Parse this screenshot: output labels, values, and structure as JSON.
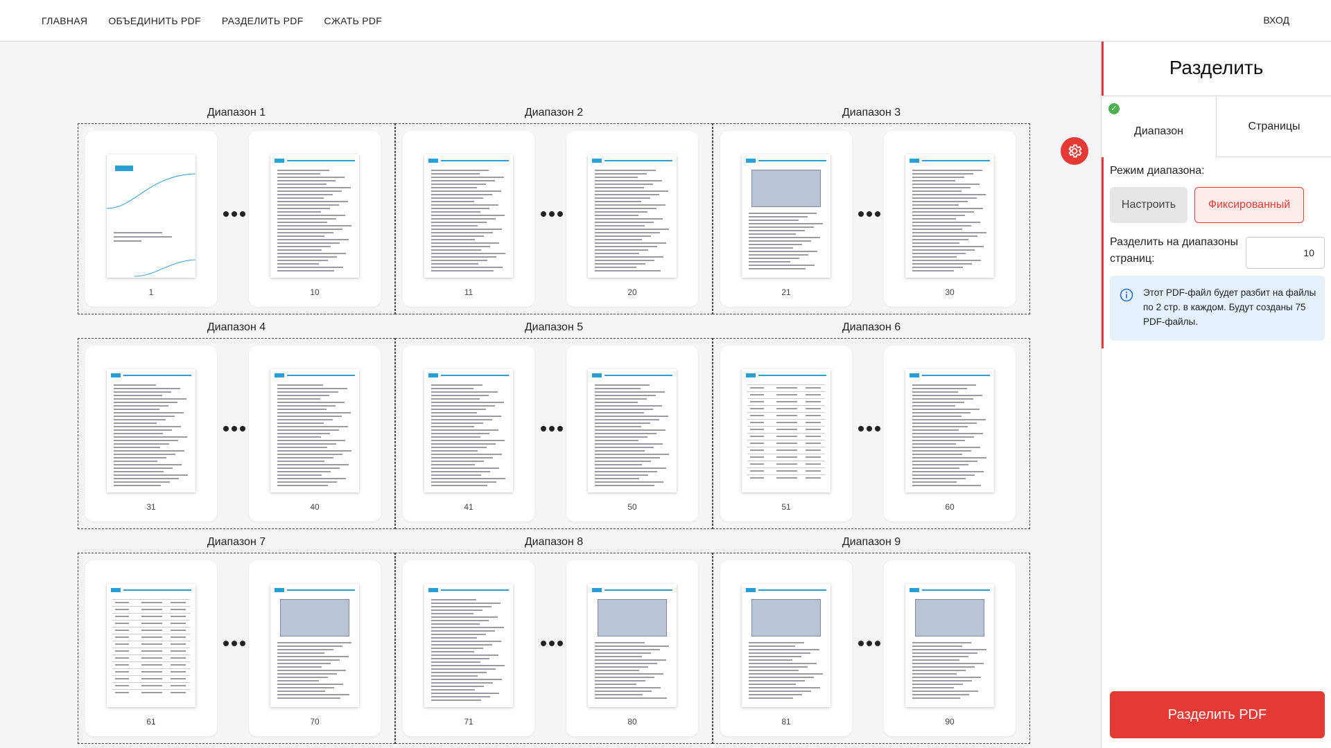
{
  "nav": {
    "items": [
      {
        "label": "ГЛАВНАЯ"
      },
      {
        "label": "ОБЪЕДИНИТЬ PDF"
      },
      {
        "label": "РАЗДЕЛИТЬ PDF"
      },
      {
        "label": "СЖАТЬ PDF"
      }
    ],
    "login": "ВХОД"
  },
  "ranges": [
    {
      "title": "Диапазон 1",
      "first": "1",
      "last": "10"
    },
    {
      "title": "Диапазон 2",
      "first": "11",
      "last": "20"
    },
    {
      "title": "Диапазон 3",
      "first": "21",
      "last": "30"
    },
    {
      "title": "Диапазон 4",
      "first": "31",
      "last": "40"
    },
    {
      "title": "Диапазон 5",
      "first": "41",
      "last": "50"
    },
    {
      "title": "Диапазон 6",
      "first": "51",
      "last": "60"
    },
    {
      "title": "Диапазон 7",
      "first": "61",
      "last": "70"
    },
    {
      "title": "Диапазон 8",
      "first": "71",
      "last": "80"
    },
    {
      "title": "Диапазон 9",
      "first": "81",
      "last": "90"
    }
  ],
  "panel": {
    "title": "Разделить",
    "tabs": {
      "range": "Диапазон",
      "pages": "Страницы"
    },
    "mode_label": "Режим диапазона:",
    "mode_custom": "Настроить",
    "mode_fixed": "Фиксированный",
    "split_label": "Разделить на диапазоны страниц:",
    "split_value": "10",
    "info": "Этот PDF-файл будет разбит на файлы по 2 стр. в каждом. Будут созданы 75 PDF-файлы.",
    "submit": "Разделить PDF"
  },
  "colors": {
    "accent": "#e53935",
    "info_bg": "#e4f1fb",
    "success": "#4caf50"
  },
  "icons": {
    "settings": "gear-icon",
    "info": "info-icon",
    "check": "check-icon"
  }
}
